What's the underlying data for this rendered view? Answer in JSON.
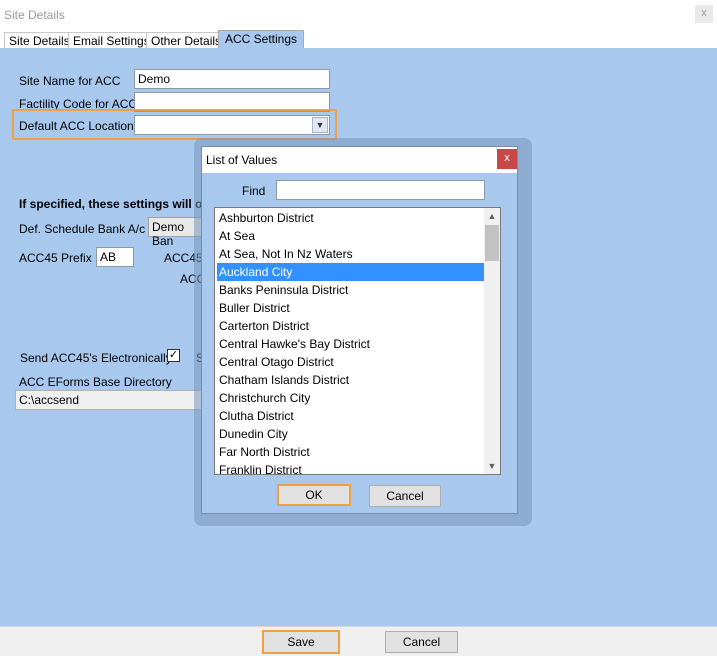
{
  "window": {
    "title": "Site Details",
    "close_glyph": "x"
  },
  "tabs": [
    {
      "label": "Site Details"
    },
    {
      "label": "Email Settings"
    },
    {
      "label": "Other Details"
    },
    {
      "label": "ACC Settings",
      "active": true
    }
  ],
  "acc_settings": {
    "site_name_label": "Site Name for ACC",
    "site_name_value": "Demo",
    "facility_code_label": "Factility Code for ACC",
    "facility_code_value": "",
    "default_location_label": "Default ACC Location",
    "default_location_value": "",
    "info_text": "If specified, these settings will o",
    "schedule_bank_label": "Def. Schedule Bank A/c",
    "schedule_bank_value": "Demo Ban",
    "acc45_prefix_label": "ACC45 Prefix",
    "acc45_prefix_value": "AB",
    "acc45_partial_1": "ACC45 C",
    "acc45_partial_2": "ACC4",
    "send_electronically_label": "Send ACC45's Electronically?",
    "send_electronically_checked": true,
    "send_partial": "S",
    "eforms_dir_label": "ACC EForms Base Directory",
    "eforms_dir_value": "C:\\accsend"
  },
  "dialog": {
    "title": "List of Values",
    "close_glyph": "x",
    "find_label": "Find",
    "find_value": "",
    "items": [
      "Ashburton District",
      "At Sea",
      "At Sea, Not In Nz Waters",
      "Auckland City",
      "Banks Peninsula District",
      "Buller District",
      "Carterton District",
      "Central Hawke's Bay District",
      "Central Otago District",
      "Chatham Islands District",
      "Christchurch City",
      "Clutha District",
      "Dunedin City",
      "Far North District",
      "Franklin District"
    ],
    "selected_index": 3,
    "ok_label": "OK",
    "cancel_label": "Cancel"
  },
  "footer": {
    "save_label": "Save",
    "cancel_label": "Cancel"
  },
  "colors": {
    "panel": "#a8c8ee",
    "focus_outline": "#f0a040",
    "selection": "#3390ff",
    "dialog_close": "#c84848"
  }
}
